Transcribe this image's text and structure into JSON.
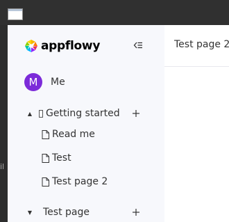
{
  "window": {
    "icon_name": "window-icon"
  },
  "desktop": {
    "edge_glyph": "il"
  },
  "brand": {
    "name": "appflowy",
    "logo_icon": "appflowy-logo-icon"
  },
  "sidebar": {
    "collapse_icon": "collapse-sidebar-icon",
    "user": {
      "initial": "M",
      "name": "Me",
      "avatar_color": "#7c2bd9"
    },
    "workspaces": [
      {
        "label": "Getting started",
        "expanded": true,
        "pages": [
          {
            "label": "Read me"
          },
          {
            "label": "Test"
          },
          {
            "label": "Test page 2"
          }
        ]
      },
      {
        "label": "Test page",
        "expanded": false,
        "pages": []
      }
    ]
  },
  "content": {
    "title": "Test page 2"
  },
  "colors": {
    "sidebar_bg": "#f7f8fc",
    "titlebar_bg": "#303030",
    "text": "#333333"
  }
}
